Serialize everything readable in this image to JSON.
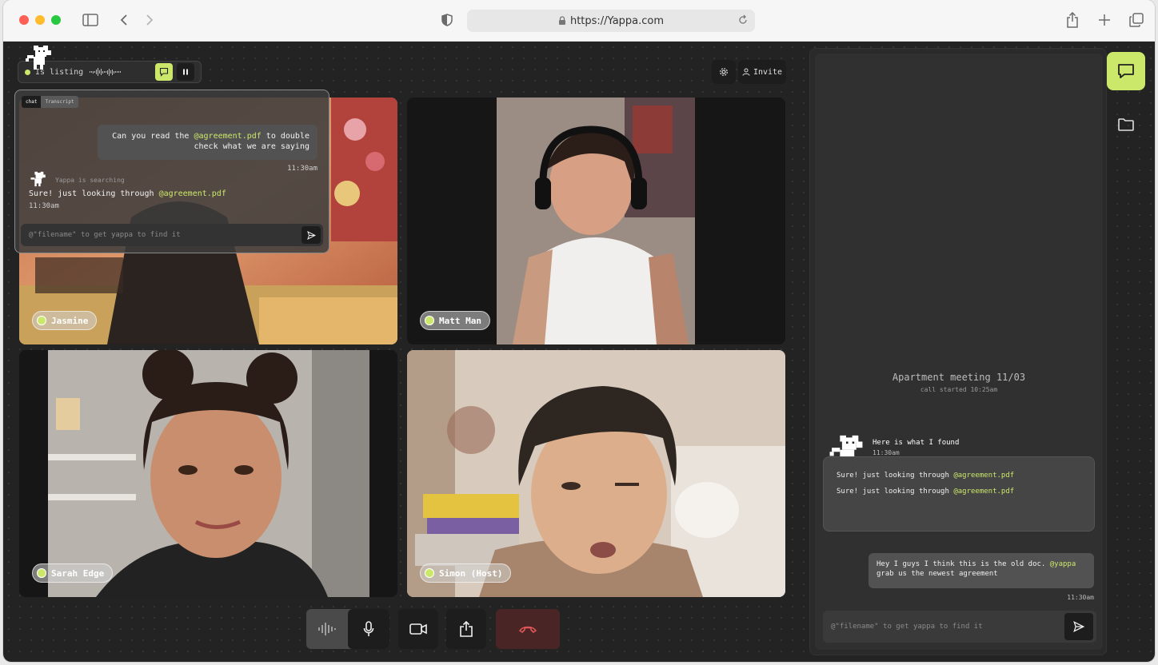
{
  "browser": {
    "url": "https://Yappa.com"
  },
  "colors": {
    "accent": "#cbe86b",
    "danger": "#e05555",
    "panel": "#303030"
  },
  "top_bar": {
    "status_text": "Is listing"
  },
  "header_buttons": {
    "invite_label": "Invite"
  },
  "participants": [
    {
      "name": "Jasmine"
    },
    {
      "name": "Matt Man"
    },
    {
      "name": "Sarah Edge"
    },
    {
      "name": "Simon (Host)"
    }
  ],
  "overlay_chat": {
    "tabs": [
      "chat",
      "Transcript"
    ],
    "user_message_pre": "Can you read the ",
    "user_message_mention": "@agreement.pdf",
    "user_message_post": " to double check what we are saying",
    "user_time": "11:30am",
    "search_note": "Yappa is searching",
    "reply_pre": "Sure! just looking through ",
    "reply_mention": "@agreement.pdf",
    "reply_time": "11:30am",
    "input_placeholder": "@\"filename\" to get yappa to find it"
  },
  "side_panel": {
    "meeting_title": "Apartment meeting 11/03",
    "meeting_sub": "call started 10:25am",
    "found_text": "Here is what I found",
    "found_time": "11:30am",
    "found_lines": [
      {
        "pre": "Sure! just looking through ",
        "mention": "@agreement.pdf"
      },
      {
        "pre": "Sure! just looking through ",
        "mention": "@agreement.pdf"
      }
    ],
    "user_msg_pre": "Hey I guys I think this is the old doc. ",
    "user_msg_mention": "@yappa",
    "user_msg_post": " grab us the newest agreement",
    "user_time": "11:30am",
    "input_placeholder": "@\"filename\" to get yappa to find it"
  }
}
